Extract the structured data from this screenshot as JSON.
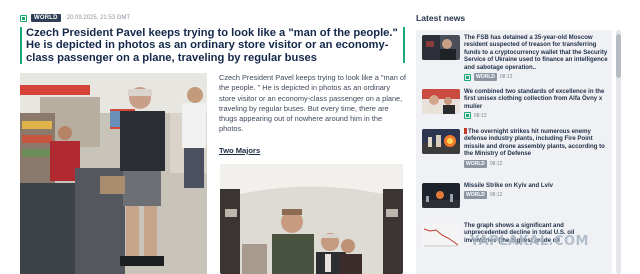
{
  "article": {
    "category": "WORLD",
    "datetime": "20.09.2025, 21:53 GMT",
    "title": "Czech President Pavel keeps trying to look like a \"man of the people.\" He is depicted in photos as an ordinary store visitor or an economy-class passenger on a plane, traveling by regular buses",
    "body": "Czech President Pavel keeps trying to look like a \"man of the people. \" He is depicted in photos as an ordinary store visitor or an economy-class passenger on a plane, traveling by regular buses. But every time, there are thugs appearing out of nowhere around him in the photos.",
    "subheading": "Two Majors"
  },
  "sidebar": {
    "title": "Latest news",
    "items": [
      {
        "text": "The FSB has detained a 35-year-old Moscow resident suspected of treason for transferring funds to a cryptocurrency wallet that the Security Service of Ukraine used to finance an intelligence and sabotage operation..",
        "badge": "WORLD",
        "time": "08:13",
        "has_flag": false
      },
      {
        "text": "We combined two standards of excellence in the first unisex clothing collection from Alfa Övny x mulíer",
        "badge": "",
        "time": "08:13",
        "has_flag": false
      },
      {
        "text": "The overnight strikes hit numerous enemy defense industry plants, including Fire Point missile and drone assembly plants, according to the Ministry of Defense",
        "badge": "WORLD",
        "time": "08:12",
        "has_flag": true
      },
      {
        "text": "Missile Strike on Kyiv and Lviv",
        "badge": "WORLD",
        "time": "08:12",
        "has_flag": false
      },
      {
        "text": "The graph shows a significant and unprecedented decline in total U.S. oil inventories (the highest grade oil",
        "badge": "",
        "time": "",
        "has_flag": false
      }
    ]
  },
  "watermark": "YAPLAKAL.COM"
}
